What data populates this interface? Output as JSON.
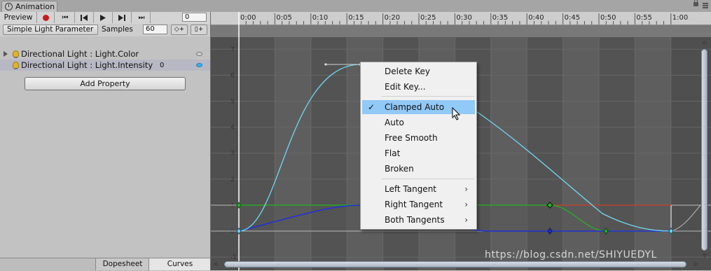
{
  "window": {
    "tab_title": "Animation",
    "lock_icon": "lock-icon",
    "menu_icon": "menu-icon"
  },
  "toolbar": {
    "preview_label": "Preview",
    "record_icon": "record-icon",
    "record_color": "#c81c1c",
    "frame_value": "0",
    "first_key_glyph": "⏮",
    "prev_key_glyph": "⏮",
    "play_glyph": "▶",
    "next_key_glyph": "⏭",
    "last_key_glyph": "⏭"
  },
  "clip": {
    "selected": "Simple Light Parameter",
    "samples_label": "Samples",
    "samples_value": "60"
  },
  "properties": [
    {
      "label": "Directional Light : Light.Color",
      "value": "",
      "icon": "bulb-icon"
    },
    {
      "label": "Directional Light : Light.Intensity",
      "value": "0",
      "icon": "bulb-icon"
    }
  ],
  "add_property_label": "Add Property",
  "bottom_tabs": {
    "dopesheet": "Dopesheet",
    "curves": "Curves"
  },
  "timeline_ticks": [
    "0:00",
    "0:05",
    "0:10",
    "0:15",
    "0:20",
    "0:25",
    "0:30",
    "0:35",
    "0:40",
    "0:45",
    "0:50",
    "0:55",
    "1:00"
  ],
  "y_ticks": [
    "7",
    "6",
    "5",
    "4",
    "3",
    "2",
    "1",
    "0",
    "-1"
  ],
  "curve_colors": {
    "intensity": "#70d8f4",
    "red": "#d03c28",
    "green": "#22b522",
    "blue": "#2030d8"
  },
  "context_menu": {
    "delete_key": "Delete Key",
    "edit_key": "Edit Key...",
    "clamped_auto": "Clamped Auto",
    "auto": "Auto",
    "free_smooth": "Free Smooth",
    "flat": "Flat",
    "broken": "Broken",
    "left_tangent": "Left Tangent",
    "right_tangent": "Right Tangent",
    "both_tangents": "Both Tangents",
    "check_glyph": "✓",
    "submenu_glyph": "›"
  },
  "watermark": "https://blog.csdn.net/SHIYUEDYL"
}
